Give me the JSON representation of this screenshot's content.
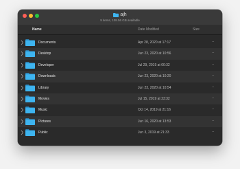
{
  "window": {
    "title": "ajh",
    "subtitle": "9 items, 108.56 GB available"
  },
  "columns": {
    "name": "Name",
    "date": "Date Modified",
    "size": "Size"
  },
  "colors": {
    "folder": "#3eb4ef",
    "close": "#fe5f57",
    "minimize": "#febc2e",
    "zoom": "#28c840"
  },
  "rows": [
    {
      "name": "Documents",
      "date": "Apr 28, 2020 at 17:17",
      "size": "--",
      "icon": "folder-icon"
    },
    {
      "name": "Desktop",
      "date": "Jun 23, 2020 at 10:56",
      "size": "--",
      "icon": "folder-icon"
    },
    {
      "name": "Developer",
      "date": "Jul 29, 2019 at 00:32",
      "size": "--",
      "icon": "folder-icon"
    },
    {
      "name": "Downloads",
      "date": "Jun 23, 2020 at 10:20",
      "size": "--",
      "icon": "folder-icon"
    },
    {
      "name": "Library",
      "date": "Jun 23, 2020 at 10:54",
      "size": "--",
      "icon": "folder-icon"
    },
    {
      "name": "Movies",
      "date": "Jul 15, 2019 at 23:32",
      "size": "--",
      "icon": "folder-icon"
    },
    {
      "name": "Music",
      "date": "Oct 14, 2019 at 21:16",
      "size": "--",
      "icon": "folder-icon"
    },
    {
      "name": "Pictures",
      "date": "Jun 16, 2020 at 13:53",
      "size": "--",
      "icon": "folder-icon"
    },
    {
      "name": "Public",
      "date": "Jun 3, 2019 at 21:33",
      "size": "--",
      "icon": "folder-icon"
    }
  ]
}
